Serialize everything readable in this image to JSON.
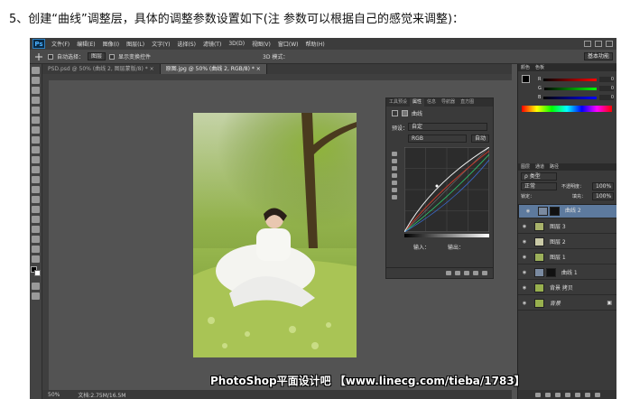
{
  "caption": "5、创建“曲线”调整层，具体的调整参数设置如下(注 参数可以根据自己的感觉来调整)：",
  "app": {
    "logo": "Ps"
  },
  "menu": [
    "文件(F)",
    "编辑(E)",
    "图像(I)",
    "图层(L)",
    "文字(Y)",
    "选择(S)",
    "滤镜(T)",
    "3D(D)",
    "视图(V)",
    "窗口(W)",
    "帮助(H)"
  ],
  "options": {
    "auto_select": "自动选择：",
    "layer_select": "图层",
    "show_transform": "显示变换控件",
    "mode_3d": "3D 模式：",
    "workspace": "基本功能"
  },
  "doc_tabs": [
    "PSD.psd @ 50% (曲线 2, 图层蒙版/8) * ×",
    "原图.jpg @ 50% (曲线 2, RGB/8) * ×"
  ],
  "status": {
    "zoom": "50%",
    "doc": "文档:2.75M/16.5M"
  },
  "properties": {
    "tabs": [
      "工具预设",
      "属性",
      "信息",
      "导航器",
      "直方图"
    ],
    "title": "曲线",
    "preset_label": "预设：",
    "preset": "自定",
    "channel": "RGB",
    "auto_btn": "自动",
    "input_label": "输入：",
    "output_label": "输出："
  },
  "color_panel": {
    "tabs": [
      "颜色",
      "色板"
    ],
    "r_label": "R",
    "g_label": "G",
    "b_label": "B",
    "r": "0",
    "g": "0",
    "b": "0"
  },
  "layers_panel": {
    "tabs": [
      "图层",
      "通道",
      "路径"
    ],
    "kind": "ρ 类型",
    "blend": "正常",
    "opacity_label": "不透明度：",
    "opacity": "100%",
    "lock_label": "锁定：",
    "fill_label": "填充：",
    "fill": "100%",
    "layers": [
      {
        "name": "曲线 2",
        "selected": true
      },
      {
        "name": "图层 3",
        "selected": false
      },
      {
        "name": "图层 2",
        "selected": false
      },
      {
        "name": "图层 1",
        "selected": false
      },
      {
        "name": "曲线 1",
        "selected": false
      },
      {
        "name": "背景 拷贝",
        "selected": false
      },
      {
        "name": "背景",
        "selected": false
      }
    ]
  },
  "watermark": "PhotoShop平面设计吧 【www.linecg.com/tieba/1783】"
}
